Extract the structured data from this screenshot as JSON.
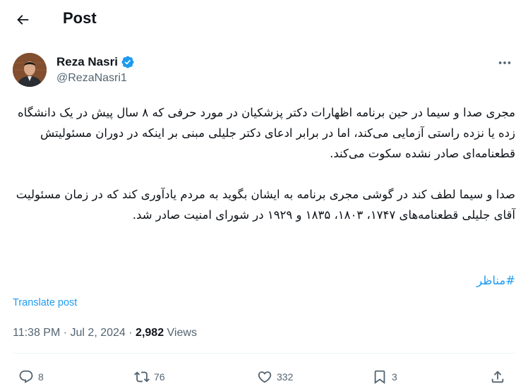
{
  "header": {
    "title": "Post"
  },
  "author": {
    "name": "Reza Nasri",
    "handle": "@RezaNasri1"
  },
  "tweet": {
    "paragraph1": "مجری صدا و سیما در حین برنامه اظهارات دکتر پزشکیان در مورد حرفی که ۸ سال پیش در یک دانشگاه زده یا نزده راستی آزمایی می‌کند، اما در برابر ادعای دکتر جلیلی مبنی بر اینکه در دوران مسئولیتش قطعنامه‌ای صادر نشده سکوت می‌کند.",
    "paragraph2": "صدا و سیما لطف کند در گوشی مجری برنامه به ایشان بگوید به مردم یادآوری کند که در زمان مسئولیت آقای جلیلی قطعنامه‌های ۱۷۴۷، ۱۸۰۳، ۱۸۳۵ و ۱۹۲۹ در شورای امنیت صادر شد.",
    "hashtag": "#مناظر"
  },
  "translate_label": "Translate post",
  "meta": {
    "time": "11:38 PM",
    "separator": "·",
    "date": "Jul 2, 2024",
    "views_count": "2,982",
    "views_label": "Views"
  },
  "actions": {
    "replies": "8",
    "reposts": "76",
    "likes": "332",
    "bookmarks": "3"
  },
  "icons": {
    "back": "arrow-left-icon",
    "verified": "verified-badge-icon",
    "more": "more-horizontal-icon",
    "reply": "reply-icon",
    "repost": "repost-icon",
    "like": "heart-icon",
    "bookmark": "bookmark-icon",
    "share": "share-icon"
  },
  "colors": {
    "accent": "#1d9bf0",
    "text": "#0f1419",
    "secondary": "#536471"
  }
}
